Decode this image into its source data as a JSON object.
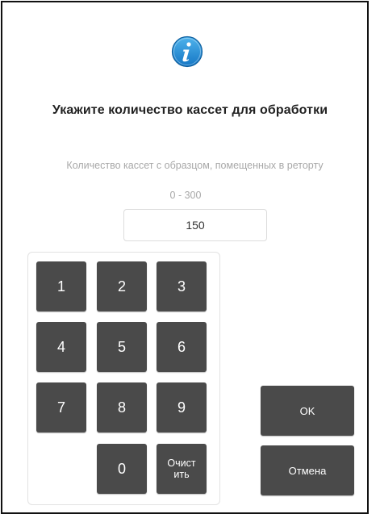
{
  "dialog": {
    "icon": "info-icon",
    "title": "Укажите количество кассет для обработки",
    "subtitle": "Количество кассет с образцом, помещенных в реторту",
    "range": "0 - 300",
    "value": "150"
  },
  "keypad": {
    "keys": [
      "1",
      "2",
      "3",
      "4",
      "5",
      "6",
      "7",
      "8",
      "9",
      "0"
    ],
    "clear_label": "Очист\nить"
  },
  "actions": {
    "ok_label": "OK",
    "cancel_label": "Отмена"
  },
  "colors": {
    "key_bg": "#4a4a4a",
    "info_blue": "#1e8fd6",
    "muted_text": "#a8a8a8"
  }
}
